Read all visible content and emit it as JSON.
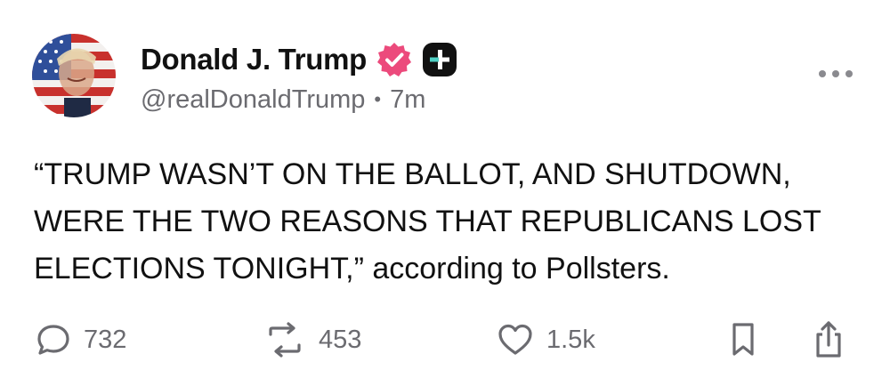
{
  "author": {
    "display_name": "Donald J. Trump",
    "handle": "@realDonaldTrump",
    "separator": "•",
    "time_ago": "7m",
    "avatar_icon": "flag-portrait-avatar",
    "verified_icon": "verified-badge-icon",
    "verified_color": "#ec4a7c",
    "plus_icon": "plus-badge-icon"
  },
  "post": {
    "text": "“TRUMP WASN’T ON THE BALLOT, AND SHUTDOWN, WERE THE TWO REASONS THAT REPUBLICANS LOST ELECTIONS TONIGHT,” according to Pollsters."
  },
  "actions": {
    "replies": "732",
    "reposts": "453",
    "likes": "1.5k"
  },
  "colors": {
    "text": "#111111",
    "muted": "#6b6b70",
    "icon": "#6b6b70"
  }
}
